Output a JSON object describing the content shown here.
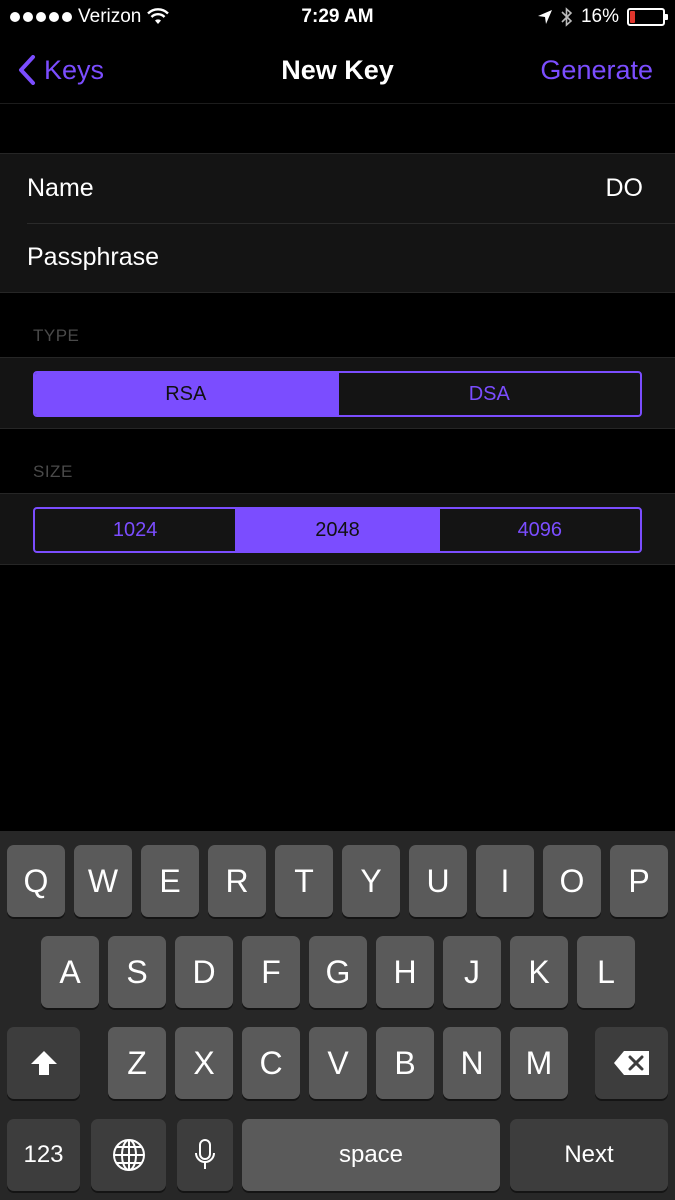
{
  "status_bar": {
    "carrier": "Verizon",
    "time": "7:29 AM",
    "battery": "16%",
    "battery_level": 0.16
  },
  "nav": {
    "back_label": "Keys",
    "title": "New Key",
    "action_label": "Generate"
  },
  "form": {
    "name_label": "Name",
    "name_value": "DO",
    "passphrase_label": "Passphrase"
  },
  "type_section": {
    "header": "TYPE",
    "options": [
      "RSA",
      "DSA"
    ],
    "selected": "RSA"
  },
  "size_section": {
    "header": "SIZE",
    "options": [
      "1024",
      "2048",
      "4096"
    ],
    "selected": "2048"
  },
  "keyboard": {
    "row1": [
      "Q",
      "W",
      "E",
      "R",
      "T",
      "Y",
      "U",
      "I",
      "O",
      "P"
    ],
    "row2": [
      "A",
      "S",
      "D",
      "F",
      "G",
      "H",
      "J",
      "K",
      "L"
    ],
    "row3": [
      "Z",
      "X",
      "C",
      "V",
      "B",
      "N",
      "M"
    ],
    "numbers_label": "123",
    "space_label": "space",
    "return_label": "Next"
  },
  "colors": {
    "accent": "#7b4dff",
    "background": "#000000",
    "cell_background": "#141414",
    "battery_low": "#e0362d"
  }
}
